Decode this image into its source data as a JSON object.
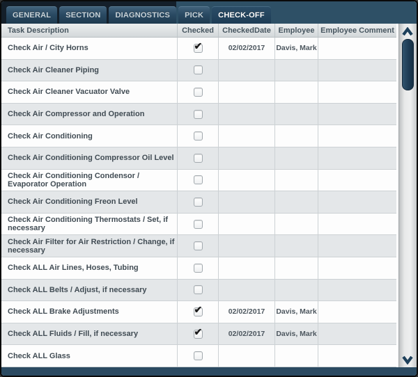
{
  "tabs": [
    {
      "label": "GENERAL",
      "active": false
    },
    {
      "label": "SECTION",
      "active": false
    },
    {
      "label": "DIAGNOSTICS",
      "active": false
    },
    {
      "label": "PICK",
      "active": false
    },
    {
      "label": "CHECK-OFF",
      "active": true
    }
  ],
  "table": {
    "columns": [
      "Task Description",
      "Checked",
      "CheckedDate",
      "Employee",
      "Employee Comment"
    ],
    "rows": [
      {
        "task": "Check Air / City Horns",
        "checked": true,
        "checkedDate": "02/02/2017",
        "employee": "Davis, Mark",
        "comment": ""
      },
      {
        "task": "Check Air Cleaner Piping",
        "checked": false,
        "checkedDate": "",
        "employee": "",
        "comment": ""
      },
      {
        "task": "Check Air Cleaner Vacuator Valve",
        "checked": false,
        "checkedDate": "",
        "employee": "",
        "comment": ""
      },
      {
        "task": "Check Air Compressor and Operation",
        "checked": false,
        "checkedDate": "",
        "employee": "",
        "comment": ""
      },
      {
        "task": "Check Air Conditioning",
        "checked": false,
        "checkedDate": "",
        "employee": "",
        "comment": ""
      },
      {
        "task": "Check Air Conditioning Compressor Oil Level",
        "checked": false,
        "checkedDate": "",
        "employee": "",
        "comment": ""
      },
      {
        "task": "Check Air Conditioning Condensor / Evaporator Operation",
        "checked": false,
        "checkedDate": "",
        "employee": "",
        "comment": ""
      },
      {
        "task": "Check Air Conditioning Freon Level",
        "checked": false,
        "checkedDate": "",
        "employee": "",
        "comment": ""
      },
      {
        "task": "Check Air Conditioning Thermostats / Set, if necessary",
        "checked": false,
        "checkedDate": "",
        "employee": "",
        "comment": ""
      },
      {
        "task": "Check Air Filter for Air Restriction / Change, if necessary",
        "checked": false,
        "checkedDate": "",
        "employee": "",
        "comment": ""
      },
      {
        "task": "Check ALL Air Lines, Hoses, Tubing",
        "checked": false,
        "checkedDate": "",
        "employee": "",
        "comment": ""
      },
      {
        "task": "Check ALL Belts / Adjust, if necessary",
        "checked": false,
        "checkedDate": "",
        "employee": "",
        "comment": ""
      },
      {
        "task": "Check ALL Brake Adjustments",
        "checked": true,
        "checkedDate": "02/02/2017",
        "employee": "Davis, Mark",
        "comment": ""
      },
      {
        "task": "Check ALL Fluids / Fill, if necessary",
        "checked": true,
        "checkedDate": "02/02/2017",
        "employee": "Davis, Mark",
        "comment": ""
      },
      {
        "task": "Check ALL Glass",
        "checked": false,
        "checkedDate": "",
        "employee": "",
        "comment": ""
      }
    ]
  },
  "icons": {
    "check": "✔"
  },
  "colors": {
    "tabbar_bg": "#2e5066",
    "tabwell_bg": "#141f2a",
    "active_tab_text": "#ffffff",
    "inactive_tab_text": "#c9d4da",
    "header_text": "#46555f",
    "row_bg": "#fdfdfd",
    "row_alt_bg": "#e4e7e9",
    "row_text": "#414c54",
    "scroll_thumb": "#1e3c55",
    "scroll_chevron": "#1e405b",
    "bottom_bar": "#2b4a61"
  }
}
